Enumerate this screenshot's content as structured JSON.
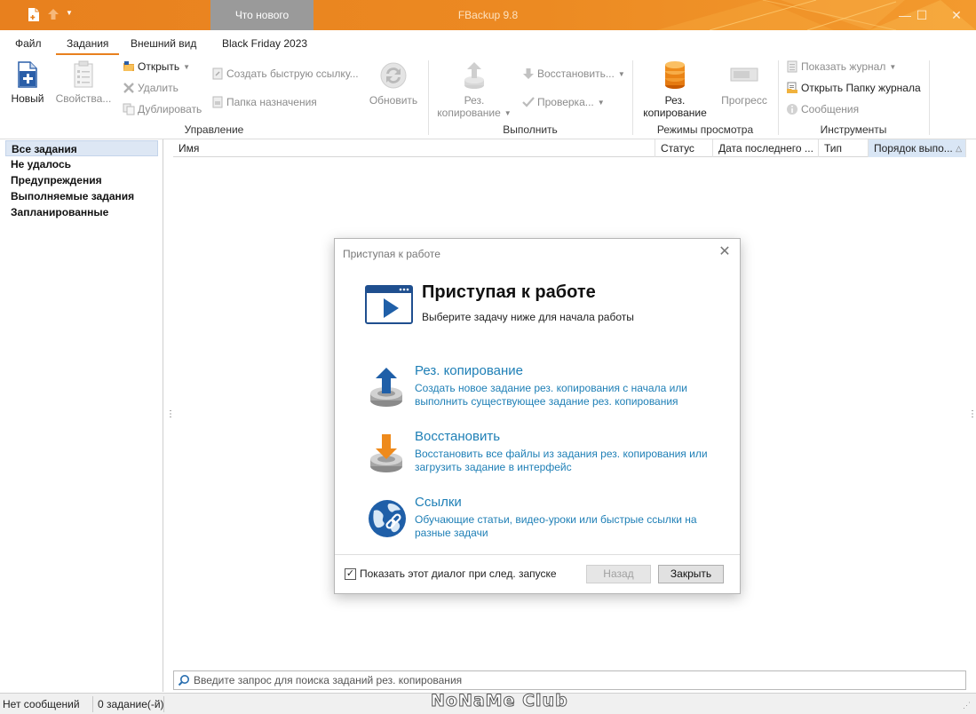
{
  "titlebar": {
    "whats_new": "Что нового",
    "app_title": "FBackup 9.8",
    "colors": {
      "accent": "#e8801e",
      "whats_new_bg": "#9a9a9a"
    }
  },
  "menu": {
    "tabs": [
      {
        "label": "Файл"
      },
      {
        "label": "Задания",
        "active": true
      },
      {
        "label": "Внешний вид"
      },
      {
        "label": "Black Friday 2023"
      }
    ]
  },
  "ribbon": {
    "groups": {
      "manage": "Управление",
      "execute": "Выполнить",
      "view_modes": "Режимы просмотра",
      "tools": "Инструменты"
    },
    "new": "Новый",
    "properties": "Свойства...",
    "open": "Открыть",
    "delete": "Удалить",
    "duplicate": "Дублировать",
    "quick_link": "Создать быструю ссылку...",
    "dest_folder": "Папка назначения",
    "refresh": "Обновить",
    "backup_line1": "Рез.",
    "backup_line2": "копирование",
    "restore": "Восстановить...",
    "check": "Проверка...",
    "view_backup_line1": "Рез.",
    "view_backup_line2": "копирование",
    "progress": "Прогресс",
    "show_log": "Показать журнал",
    "open_log_folder": "Открыть Папку журнала",
    "messages": "Сообщения"
  },
  "sidebar": {
    "items": [
      {
        "label": "Все задания",
        "selected": true
      },
      {
        "label": "Не удалось"
      },
      {
        "label": "Предупреждения"
      },
      {
        "label": "Выполняемые задания"
      },
      {
        "label": "Запланированные"
      }
    ]
  },
  "table": {
    "columns": [
      {
        "label": "Имя"
      },
      {
        "label": "Статус"
      },
      {
        "label": "Дата последнего ..."
      },
      {
        "label": "Тип"
      },
      {
        "label": "Порядок выпо...",
        "sorted": true
      }
    ]
  },
  "search": {
    "placeholder": "Введите запрос для поиска заданий рез. копирования"
  },
  "statusbar": {
    "messages": "Нет сообщений",
    "jobs": "0 задание(-й)",
    "watermark": "NoNaMe Club"
  },
  "dialog": {
    "window_title": "Приступая к работе",
    "heading": "Приступая к работе",
    "subheading": "Выберите задачу ниже для начала работы",
    "tasks": [
      {
        "title": "Рез. копирование",
        "desc": "Создать новое задание рез. копирования с начала или выполнить существующее задание рез. копирования"
      },
      {
        "title": "Восстановить",
        "desc": "Восстановить все файлы из задания рез. копирования или загрузить задание в интерфейс"
      },
      {
        "title": "Ссылки",
        "desc": "Обучающие статьи, видео-уроки или быстрые ссылки на разные задачи"
      }
    ],
    "show_on_start": "Показать этот диалог при след. запуске",
    "show_on_start_checked": true,
    "back_button": "Назад",
    "close_button": "Закрыть",
    "colors": {
      "link": "#1e7fb6"
    }
  }
}
